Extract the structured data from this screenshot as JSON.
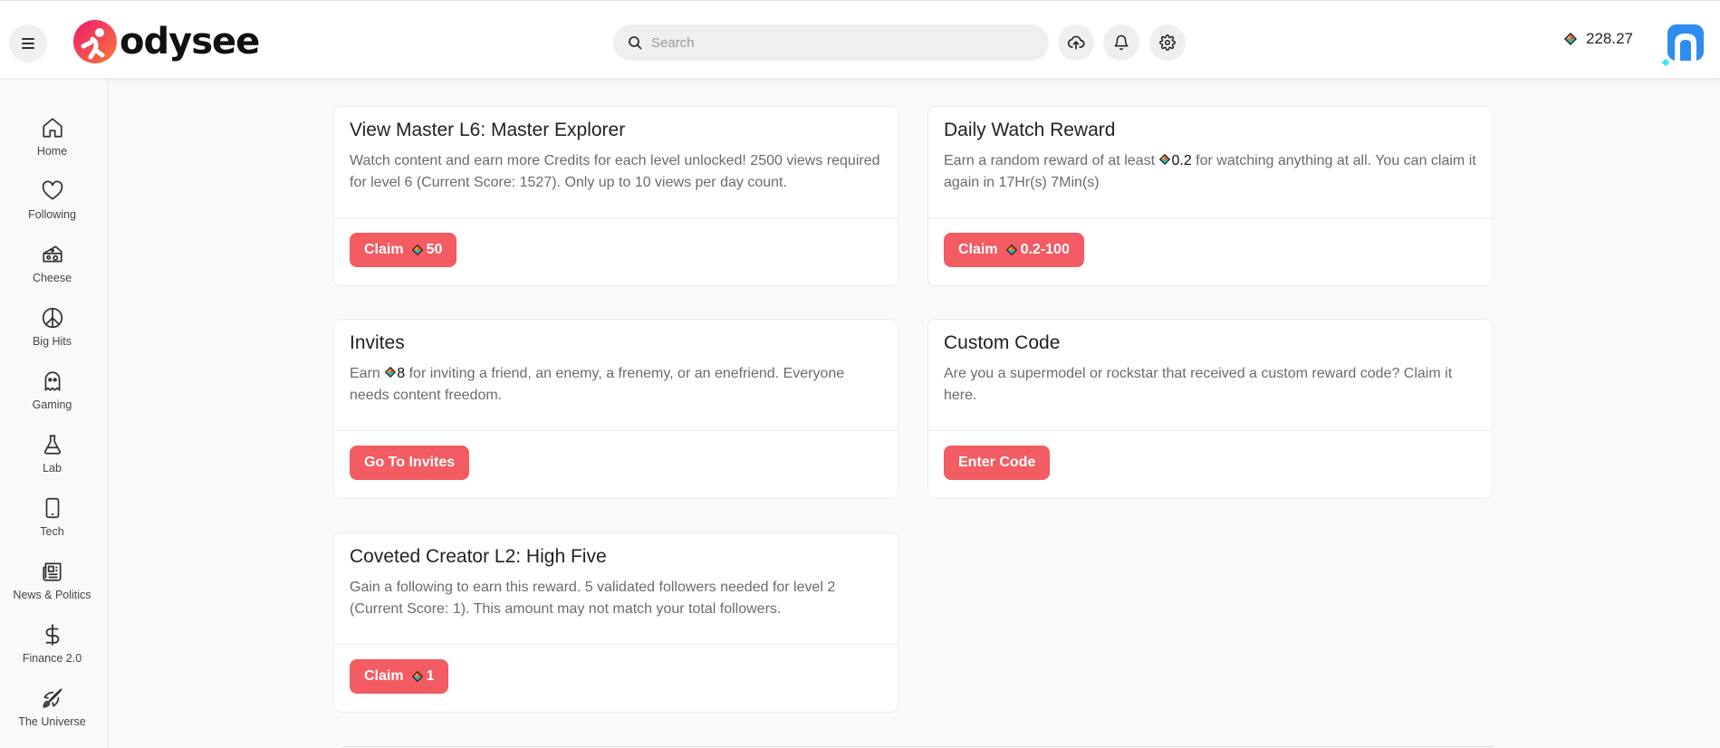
{
  "header": {
    "logo_text": "odysee",
    "search_placeholder": "Search",
    "balance": "228.27"
  },
  "sidebar": {
    "items": [
      {
        "label": "Home",
        "icon": "home-icon"
      },
      {
        "label": "Following",
        "icon": "heart-icon"
      },
      {
        "label": "Cheese",
        "icon": "cheese-icon"
      },
      {
        "label": "Big Hits",
        "icon": "peace-icon"
      },
      {
        "label": "Gaming",
        "icon": "ghost-icon"
      },
      {
        "label": "Lab",
        "icon": "flask-icon"
      },
      {
        "label": "Tech",
        "icon": "phone-icon"
      },
      {
        "label": "News & Politics",
        "icon": "newspaper-icon"
      },
      {
        "label": "Finance 2.0",
        "icon": "dollar-icon"
      },
      {
        "label": "The Universe",
        "icon": "rocket-icon"
      }
    ]
  },
  "cards": {
    "view_master": {
      "title": "View Master L6: Master Explorer",
      "desc": "Watch content and earn more Credits for each level unlocked! 2500 views required for level 6 (Current Score: 1527). Only up to 10 views per day count.",
      "btn_label": "Claim",
      "btn_amount": "50"
    },
    "daily_watch": {
      "title": "Daily Watch Reward",
      "desc_pre": "Earn a random reward of at least",
      "desc_amount": "0.2",
      "desc_post": "for watching anything at all. You can claim it again in 17Hr(s) 7Min(s)",
      "btn_label": "Claim",
      "btn_amount": "0.2-100"
    },
    "invites": {
      "title": "Invites",
      "desc_pre": "Earn",
      "desc_amount": "8",
      "desc_post": "for inviting a friend, an enemy, a frenemy, or an enefriend. Everyone needs content freedom.",
      "btn_label": "Go To Invites"
    },
    "custom_code": {
      "title": "Custom Code",
      "desc": "Are you a supermodel or rockstar that received a custom reward code? Claim it here.",
      "btn_label": "Enter Code"
    },
    "coveted_creator": {
      "title": "Coveted Creator L2: High Five",
      "desc": "Gain a following to earn this reward. 5 validated followers needed for level 2 (Current Score: 1). This amount may not match your total followers.",
      "btn_label": "Claim",
      "btn_amount": "1"
    }
  },
  "colors": {
    "accent": "#f25c62",
    "avatar": "#2f8cf0"
  }
}
